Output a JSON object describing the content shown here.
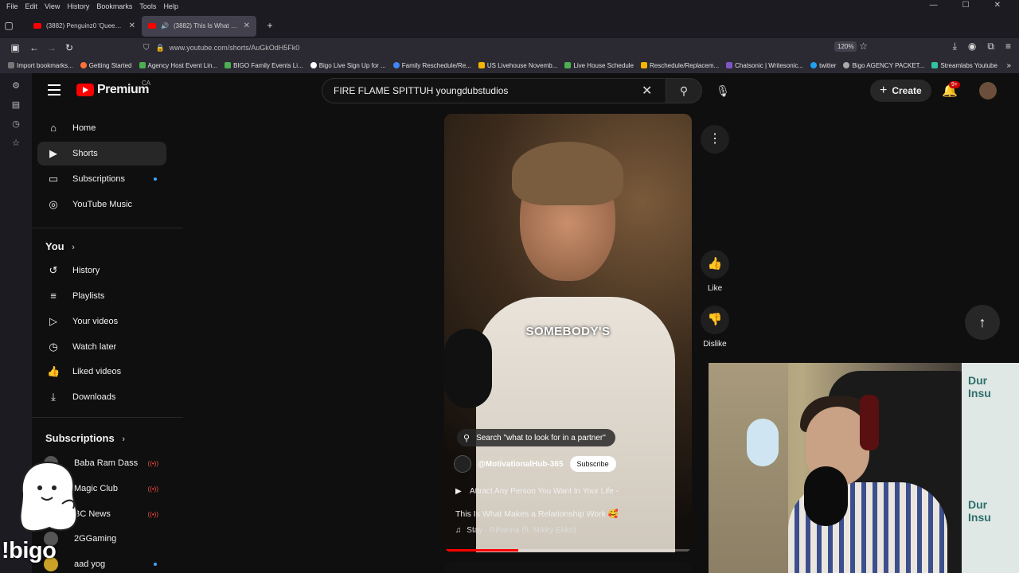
{
  "browser": {
    "menu": [
      "File",
      "Edit",
      "View",
      "History",
      "Bookmarks",
      "Tools",
      "Help"
    ],
    "tabs": [
      {
        "title": "(3882) Penguinz0 'Queens Cring",
        "active": false
      },
      {
        "title": "(3882) This Is What Makes a",
        "active": true
      }
    ],
    "url": "www.youtube.com/shorts/AuGkOdH5Fk0",
    "zoom": "120%",
    "bookmarks": [
      "Import bookmarks...",
      "Getting Started",
      "Agency Host Event Lin...",
      "BIGO Family Events Li...",
      "Bigo Live Sign Up for ...",
      "Family Reschedule/Re...",
      "US Livehouse Novemb...",
      "Live House Schedule",
      "Reschedule/Replacem...",
      "Chatsonic | Writesonic...",
      "twitter",
      "Bigo AGENCY PACKET...",
      "Streamlabs Youtube"
    ]
  },
  "header": {
    "logo_text": "Premium",
    "region": "CA",
    "search_value": "FIRE FLAME SPITTUH youngdubstudios",
    "create_label": "Create",
    "notif_badge": "9+"
  },
  "sidebar": {
    "main": [
      {
        "label": "Home",
        "icon": "home-icon"
      },
      {
        "label": "Shorts",
        "icon": "shorts-icon",
        "active": true
      },
      {
        "label": "Subscriptions",
        "icon": "subscriptions-icon"
      },
      {
        "label": "YouTube Music",
        "icon": "music-icon"
      }
    ],
    "you_label": "You",
    "you": [
      {
        "label": "History",
        "icon": "history-icon"
      },
      {
        "label": "Playlists",
        "icon": "playlists-icon"
      },
      {
        "label": "Your videos",
        "icon": "your-videos-icon"
      },
      {
        "label": "Watch later",
        "icon": "watch-later-icon"
      },
      {
        "label": "Liked videos",
        "icon": "liked-icon"
      },
      {
        "label": "Downloads",
        "icon": "download-icon"
      }
    ],
    "subs_label": "Subscriptions",
    "subs": [
      {
        "label": "Baba Ram Dass",
        "live": true
      },
      {
        "label": "Magic Club",
        "live": true
      },
      {
        "label": "BC News",
        "live": true
      },
      {
        "label": "2GGaming",
        "live": false
      },
      {
        "label": "aad yog",
        "live": false
      }
    ]
  },
  "short": {
    "caption": "SOMEBODY'S",
    "search_suggestion": "Search \"what to look for in a partner\"",
    "channel": "@MotivationalHub-365",
    "subscribe_label": "Subscribe",
    "playlist_line": "Attract Any Person You Want In Your Life -",
    "title": "This Is What Makes a Relationship Work 🥰",
    "music": "Stay · Rihanna (ft. Mikky Ekko)",
    "progress": 0.3
  },
  "actions": {
    "like_label": "Like",
    "dislike_label": "Dislike"
  },
  "overlay": {
    "bigo_text": "!bigo",
    "banner_line1": "Dur",
    "banner_line2": "Insu"
  }
}
